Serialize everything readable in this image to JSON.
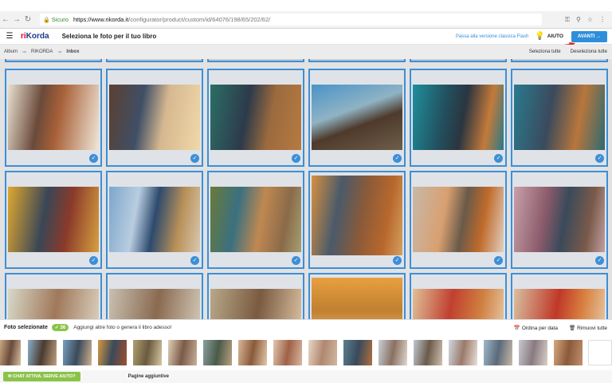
{
  "browser": {
    "secure_label": "Sicuro",
    "url_host": "https://www.rikorda.it",
    "url_path": "/configurator/product/custom/id/64076/198/65/202/62/"
  },
  "header": {
    "logo_main": "ri",
    "logo_accent": "Korda",
    "title": "Seleziona le foto per il tuo libro",
    "flash_link": "Passa alla versione classica Flash",
    "help_label": "AIUTO",
    "next_label": "AVANTI"
  },
  "breadcrumb": {
    "items": [
      "Album",
      "RIKORDA",
      "Inbox"
    ],
    "select_all": "Seleziona tutte",
    "deselect_all": "Deseleziona tutte"
  },
  "colors": {
    "accent": "#3d8fd6",
    "brand_red": "#e2001a",
    "badge_green": "#8bc34a"
  },
  "selection": {
    "title": "Foto selezionate",
    "count": "36",
    "hint": "Aggiungi altre foto o genera il libro adesso!",
    "sort_label": "Ordina per data",
    "remove_label": "Rimuovi tutte"
  },
  "footer": {
    "chat_label": "CHAT ATTIVA. SERVE AIUTO?",
    "pages_label": "Pagine aggiuntive"
  }
}
